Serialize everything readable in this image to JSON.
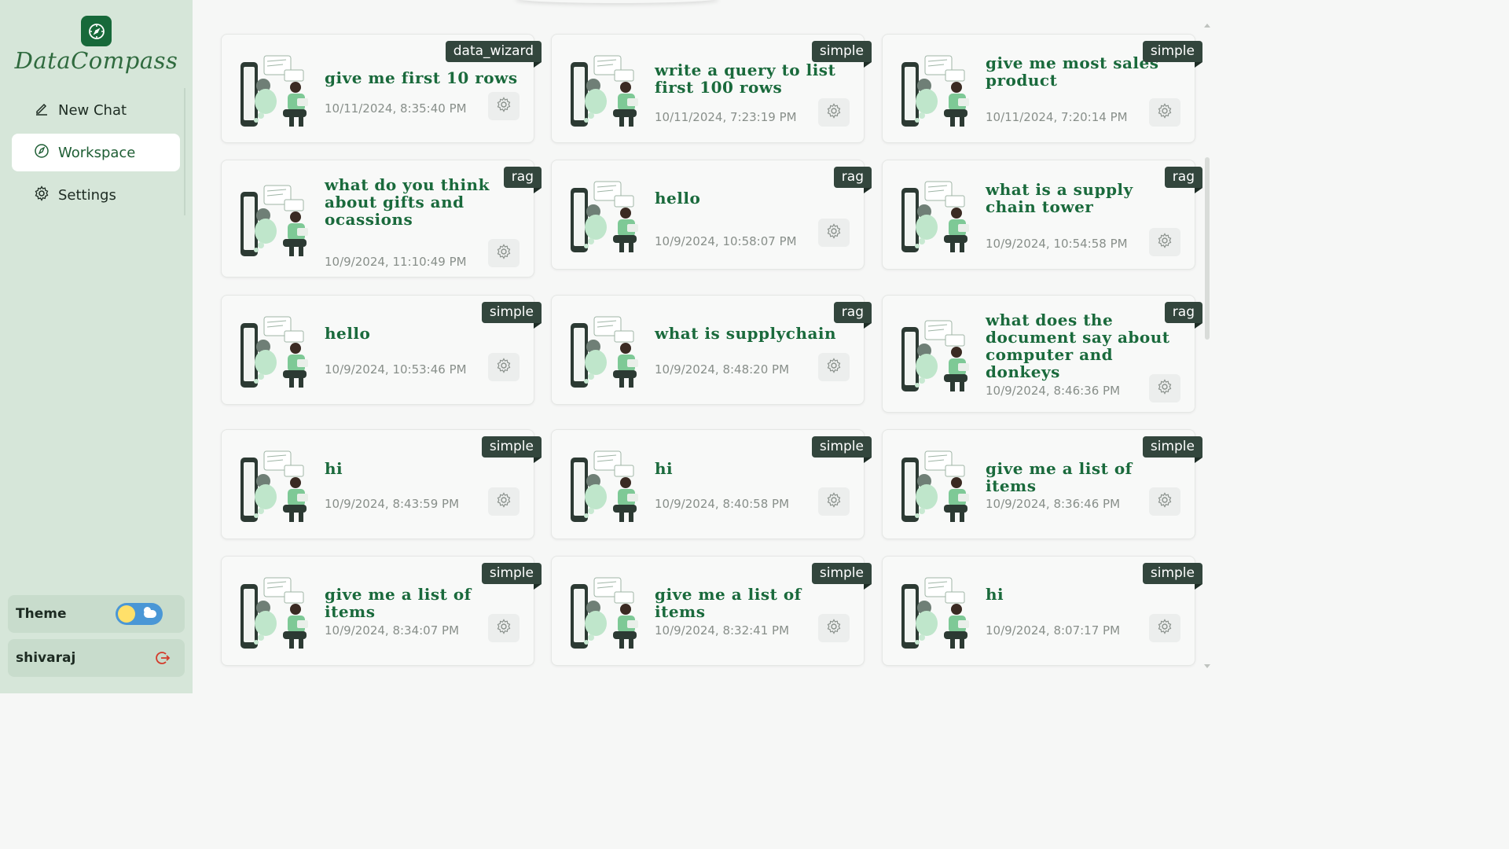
{
  "app": {
    "brand": "DataCompass"
  },
  "sidebar": {
    "items": [
      {
        "label": "New Chat",
        "icon": "pencil-icon"
      },
      {
        "label": "Workspace",
        "icon": "compass-icon",
        "active": true
      },
      {
        "label": "Settings",
        "icon": "gear-icon"
      }
    ],
    "theme_label": "Theme",
    "user_name": "shivaraj"
  },
  "colors": {
    "accent": "#1a6a3c",
    "sidebar_bg": "#d6e6d9",
    "tag_bg": "#33463d"
  },
  "cards": [
    {
      "title": "give me first 10 rows",
      "date": "10/11/2024, 8:35:40 PM",
      "tag": "data_wizard"
    },
    {
      "title": "write a query to list first 100 rows",
      "date": "10/11/2024, 7:23:19 PM",
      "tag": "simple"
    },
    {
      "title": "give me most sales product",
      "date": "10/11/2024, 7:20:14 PM",
      "tag": "simple"
    },
    {
      "title": "what do you think about gifts and ocassions",
      "date": "10/9/2024, 11:10:49 PM",
      "tag": "rag"
    },
    {
      "title": "hello",
      "date": "10/9/2024, 10:58:07 PM",
      "tag": "rag"
    },
    {
      "title": "what is a supply chain tower",
      "date": "10/9/2024, 10:54:58 PM",
      "tag": "rag"
    },
    {
      "title": "hello",
      "date": "10/9/2024, 10:53:46 PM",
      "tag": "simple"
    },
    {
      "title": "what is supplychain",
      "date": "10/9/2024, 8:48:20 PM",
      "tag": "rag"
    },
    {
      "title": "what does the document say about computer and donkeys",
      "date": "10/9/2024, 8:46:36 PM",
      "tag": "rag"
    },
    {
      "title": "hi",
      "date": "10/9/2024, 8:43:59 PM",
      "tag": "simple"
    },
    {
      "title": "hi",
      "date": "10/9/2024, 8:40:58 PM",
      "tag": "simple"
    },
    {
      "title": "give me a list of items",
      "date": "10/9/2024, 8:36:46 PM",
      "tag": "simple"
    },
    {
      "title": "give me a list of items",
      "date": "10/9/2024, 8:34:07 PM",
      "tag": "simple"
    },
    {
      "title": "give me a list of items",
      "date": "10/9/2024, 8:32:41 PM",
      "tag": "simple"
    },
    {
      "title": "hi",
      "date": "10/9/2024, 8:07:17 PM",
      "tag": "simple"
    }
  ]
}
